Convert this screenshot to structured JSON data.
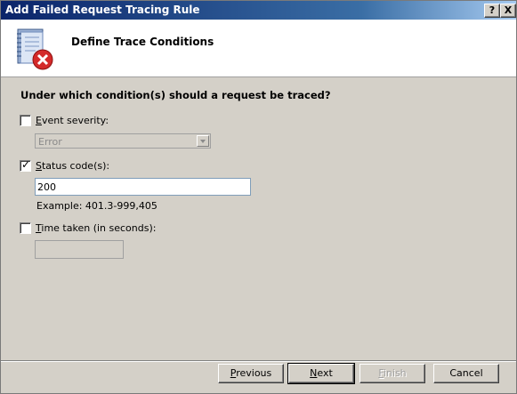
{
  "window": {
    "title": "Add Failed Request Tracing Rule",
    "help_label": "?",
    "close_label": "X"
  },
  "header": {
    "title": "Define Trace Conditions",
    "icon": "log-file-with-error-icon"
  },
  "question": "Under which condition(s) should a request be traced?",
  "conditions": {
    "event_severity": {
      "label_hot": "E",
      "label_rest": "vent severity:",
      "checked": false,
      "value": "Error"
    },
    "status_code": {
      "label_hot": "S",
      "label_rest": "tatus code(s):",
      "checked": true,
      "value": "200",
      "example": "Example: 401.3-999,405"
    },
    "time_taken": {
      "label_hot": "T",
      "label_rest": "ime taken (in seconds):",
      "checked": false,
      "value": ""
    }
  },
  "buttons": {
    "previous": {
      "hot": "P",
      "rest": "revious"
    },
    "next": {
      "hot": "N",
      "rest": "ext"
    },
    "finish": {
      "hot": "F",
      "rest": "inish"
    },
    "cancel": "Cancel"
  }
}
